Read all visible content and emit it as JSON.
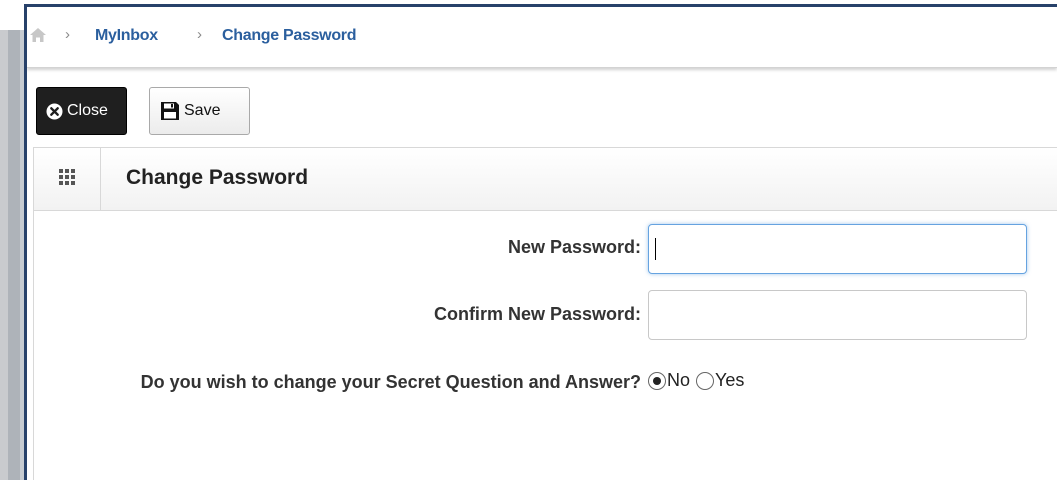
{
  "breadcrumb": {
    "items": [
      "MyInbox",
      "Change Password"
    ]
  },
  "toolbar": {
    "close_label": "Close",
    "save_label": "Save"
  },
  "panel": {
    "title": "Change Password"
  },
  "form": {
    "new_password_label": "New Password:",
    "new_password_value": "",
    "confirm_password_label": "Confirm New Password:",
    "confirm_password_value": "",
    "secret_question_prompt": "Do you wish to change your Secret Question and Answer?",
    "options": [
      {
        "label": "No",
        "selected": true
      },
      {
        "label": "Yes",
        "selected": false
      }
    ]
  },
  "icons": {
    "home": "home-icon",
    "close": "close-circle-icon",
    "save": "floppy-disk-icon",
    "grid": "grid-icon"
  },
  "colors": {
    "link": "#2b5f9e",
    "frame": "#27416a",
    "close_button": "#1f1f1f",
    "focus": "#66a3e0"
  }
}
